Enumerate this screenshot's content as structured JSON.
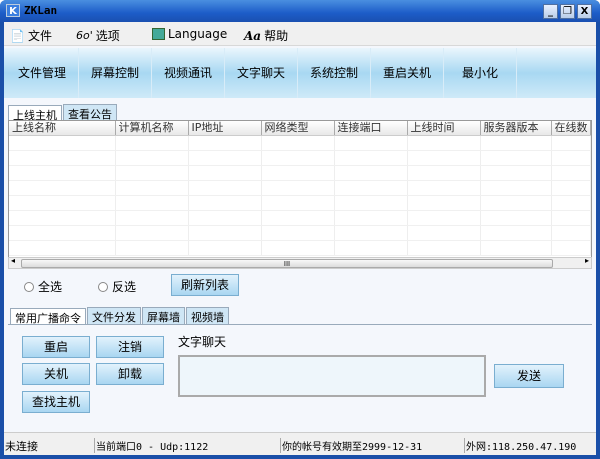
{
  "window": {
    "title": "ZKLan",
    "logo": "K",
    "minimize": "_",
    "restore": "❐",
    "close": "X"
  },
  "menu": [
    {
      "label": "文件",
      "icon": "file-icon"
    },
    {
      "label": "选项",
      "icon": "glasses-icon"
    },
    {
      "label": "Language",
      "icon": "language-icon"
    },
    {
      "label": "帮助",
      "icon": "help-font-icon"
    }
  ],
  "toolbar": [
    "文件管理",
    "屏幕控制",
    "视频通讯",
    "文字聊天",
    "系统控制",
    "重启关机",
    "最小化"
  ],
  "top_tabs": [
    "上线主机",
    "查看公告"
  ],
  "columns": [
    "上线名称",
    "计算机名称",
    "IP地址",
    "网络类型",
    "连接端口",
    "上线时间",
    "服务器版本",
    "在线数"
  ],
  "scroll_thumb": "III",
  "select": {
    "all": "全选",
    "invert": "反选",
    "refresh": "刷新列表"
  },
  "bottom_tabs": [
    "常用广播命令",
    "文件分发",
    "屏幕墙",
    "视频墙"
  ],
  "commands": {
    "restart": "重启",
    "logoff": "注销",
    "shutdown": "关机",
    "uninstall": "卸载",
    "find_host": "查找主机"
  },
  "chat": {
    "label": "文字聊天",
    "value": "",
    "send": "发送"
  },
  "status": {
    "connection": "未连接",
    "port": "当前端口0 - Udp:1122",
    "expiry": "你的帐号有效期至2999-12-31",
    "external_ip": "外网:118.250.47.190"
  }
}
